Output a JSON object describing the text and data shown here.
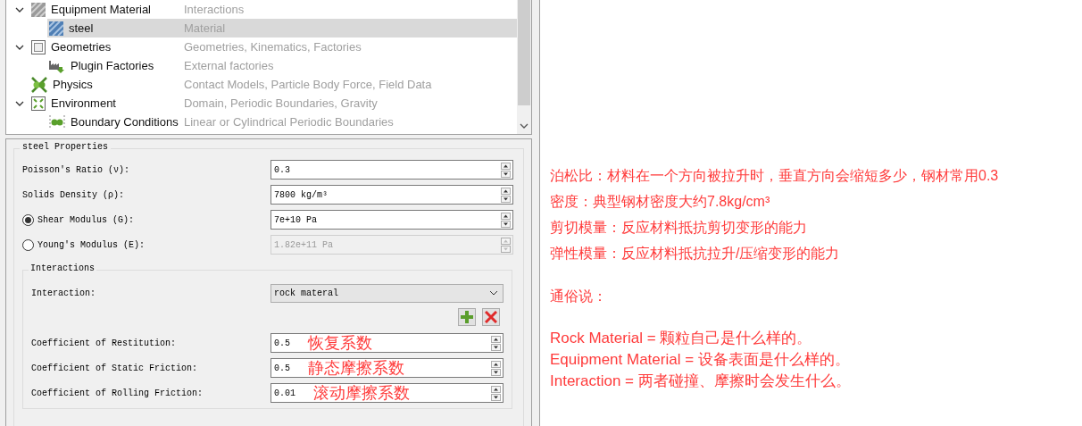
{
  "tree": {
    "items": [
      {
        "name": "Equipment Material",
        "description": "Interactions",
        "expanded": true,
        "selected": false,
        "children": [
          {
            "name": "steel",
            "description": "Material",
            "selected": true
          }
        ]
      },
      {
        "name": "Geometries",
        "description": "Geometries, Kinematics, Factories",
        "expanded": true,
        "selected": false,
        "children": [
          {
            "name": "Plugin Factories",
            "description": "External factories",
            "selected": false
          }
        ]
      },
      {
        "name": "Physics",
        "description": "Contact Models, Particle Body Force, Field Data",
        "selected": false
      },
      {
        "name": "Environment",
        "description": "Domain, Periodic Boundaries, Gravity",
        "expanded": true,
        "selected": false,
        "children": [
          {
            "name": "Boundary Conditions",
            "description": "Linear or Cylindrical Periodic Boundaries",
            "selected": false
          }
        ]
      }
    ]
  },
  "properties": {
    "title": "steel Properties",
    "fields": [
      {
        "kind": "spin",
        "label": "Poisson's Ratio (ν):",
        "value": "0.3",
        "disabled": false
      },
      {
        "kind": "spin",
        "label": "Solids Density (ρ):",
        "value": "7800 kg/m³",
        "disabled": false
      },
      {
        "kind": "radio",
        "label": "Shear Modulus (G):",
        "value": "7e+10 Pa",
        "selected": true,
        "disabled": false
      },
      {
        "kind": "radio",
        "label": "Young's Modulus (E):",
        "value": "1.82e+11 Pa",
        "selected": false,
        "disabled": true
      }
    ],
    "interactions": {
      "title": "Interactions",
      "label": "Interaction:",
      "value": "rock materal",
      "coefficients": [
        {
          "label": "Coefficient of Restitution:",
          "value": "0.5",
          "note": "恢复系数"
        },
        {
          "label": "Coefficient of Static Friction:",
          "value": "0.5",
          "note": "静态摩擦系数"
        },
        {
          "label": "Coefficient of Rolling Friction:",
          "value": "0.01",
          "note": "滚动摩擦系数"
        }
      ]
    }
  },
  "notes": {
    "definitions": [
      "泊松比：材料在一个方向被拉升时，垂直方向会缩短多少，钢材常用0.3",
      "密度：典型钢材密度大约7.8kg/cm³",
      "剪切模量：反应材料抵抗剪切变形的能力",
      "弹性模量：反应材料抵抗拉升/压缩变形的能力"
    ],
    "heading": "通俗说：",
    "summary": [
      "Rock Material = 颗粒自己是什么样的。",
      "Equipment Material = 设备表面是什么样的。",
      "Interaction = 两者碰撞、摩擦时会发生什么。"
    ]
  }
}
